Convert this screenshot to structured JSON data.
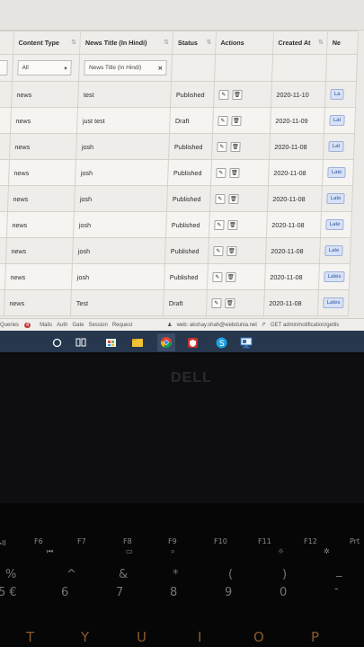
{
  "table": {
    "headers": {
      "content_type": "Content Type",
      "news_title": "News Title (In Hindi)",
      "status": "Status",
      "actions": "Actions",
      "created_at": "Created At",
      "next": "Ne"
    },
    "filters": {
      "content_type_value": "All",
      "news_title_placeholder": "News Title (In Hindi)"
    },
    "rows": [
      {
        "type": "news",
        "title": "test",
        "status": "Published",
        "created": "2020-11-10",
        "badge": "La"
      },
      {
        "type": "news",
        "title": "just test",
        "status": "Draft",
        "created": "2020-11-09",
        "badge": "Lat"
      },
      {
        "type": "news",
        "title": "josh",
        "status": "Published",
        "created": "2020-11-08",
        "badge": "Lat"
      },
      {
        "type": "news",
        "title": "josh",
        "status": "Published",
        "created": "2020-11-08",
        "badge": "Late"
      },
      {
        "type": "news",
        "title": "josh",
        "status": "Published",
        "created": "2020-11-08",
        "badge": "Late"
      },
      {
        "type": "news",
        "title": "josh",
        "status": "Published",
        "created": "2020-11-08",
        "badge": "Late"
      },
      {
        "type": "news",
        "title": "josh",
        "status": "Published",
        "created": "2020-11-08",
        "badge": "Late"
      },
      {
        "type": "news",
        "title": "josh",
        "status": "Published",
        "created": "2020-11-08",
        "badge": "Lates"
      },
      {
        "type": "news",
        "title": "Test",
        "status": "Draft",
        "created": "2020-11-08",
        "badge": "Lates"
      }
    ]
  },
  "debugbar": {
    "queries": "Queries",
    "queries_count": "4",
    "mails": "Mails",
    "auth": "Auth",
    "gate": "Gate",
    "session": "Session",
    "request": "Request",
    "user": "web: akshay.shah@webdunia.net",
    "route": "GET admin/notification/getlis"
  },
  "taskbar": {
    "icons": [
      "cortana-icon",
      "task-view-icon",
      "store-icon",
      "file-explorer-icon",
      "chrome-icon",
      "security-icon",
      "skype-icon",
      "remote-desktop-icon"
    ]
  },
  "laptop": {
    "brand": "DELL",
    "fkeys": [
      "F6",
      "F7",
      "F8",
      "F9",
      "F10",
      "F11",
      "F12",
      "Prt"
    ],
    "number_top": [
      "%",
      "^",
      "&",
      "*",
      "(",
      ")",
      "_"
    ],
    "number_main": [
      "5 €",
      "6",
      "7",
      "8",
      "9",
      "0",
      "-"
    ],
    "letters": [
      "T",
      "Y",
      "U",
      "I",
      "O",
      "P"
    ]
  },
  "colors": {
    "taskbar": "#26374e",
    "badge_blue": "#2f57a6",
    "backlight": "#8b5a2a"
  }
}
